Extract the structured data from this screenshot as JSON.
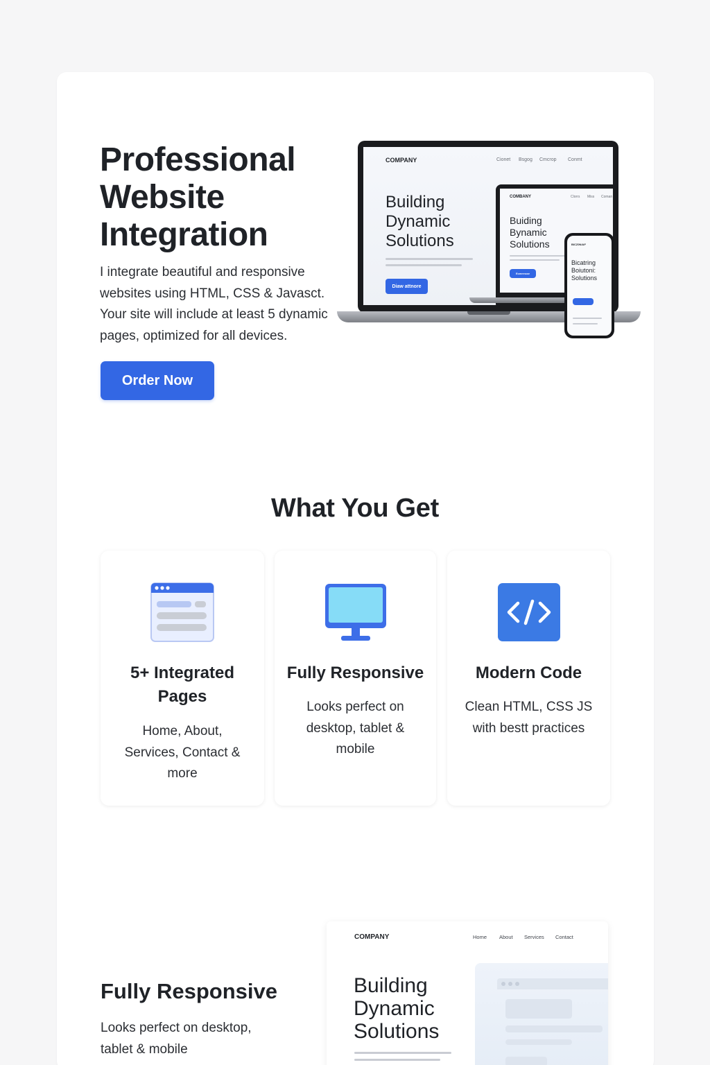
{
  "hero": {
    "title": "Professional Website Integration",
    "description": "I integrate beautiful and responsive websites using HTML, CSS & Javasct. Your site will include at least 5 dynamic pages, optimized for all devices.",
    "order_button": "Order Now"
  },
  "mockup": {
    "laptop": {
      "logo": "COMPANY",
      "nav": [
        "Cionet",
        "Bsgog",
        "Cmcrop",
        "Conmt"
      ],
      "headline": "Building Dynamic Solutions",
      "button": "Diaw attnore"
    },
    "tablet": {
      "logo": "COMBANY",
      "nav": [
        "Clorrs",
        "Miss",
        "Coman"
      ],
      "headline": "Buiding Bynamic Solutions",
      "button": "Ecmrrncar"
    },
    "phone": {
      "logo": "BICZ0N/AF",
      "headline": "Bicatring Boiutoni: Solutions"
    }
  },
  "features_section": {
    "title": "What You Get",
    "items": [
      {
        "icon": "browser-window-icon",
        "title": "5+ Integrated Pages",
        "description": "Home, About, Services, Contact & more"
      },
      {
        "icon": "monitor-icon",
        "title": "Fully Responsive",
        "description": "Looks perfect on desktop, tablet & mobile"
      },
      {
        "icon": "code-icon",
        "title": "Modern Code",
        "description": "Clean HTML, CSS JS with bestt practices"
      }
    ]
  },
  "responsive_section": {
    "title": "Fully Responsive",
    "description": "Looks perfect on desktop, tablet & mobile",
    "preview": {
      "logo": "COMPANY",
      "nav": [
        "Home",
        "About",
        "Services",
        "Contact"
      ],
      "headline": "Building Dynamic Solutions"
    }
  },
  "colors": {
    "accent": "#3367e4",
    "background": "#f6f6f7",
    "card": "#ffffff",
    "text": "#1f2227"
  }
}
